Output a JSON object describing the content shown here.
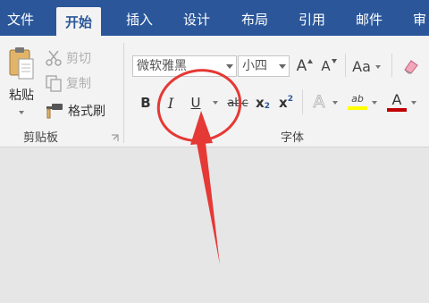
{
  "tabs": [
    {
      "label": "文件"
    },
    {
      "label": "开始"
    },
    {
      "label": "插入"
    },
    {
      "label": "设计"
    },
    {
      "label": "布局"
    },
    {
      "label": "引用"
    },
    {
      "label": "邮件"
    },
    {
      "label": "审"
    }
  ],
  "clipboard": {
    "paste_label": "粘贴",
    "cut_label": "剪切",
    "copy_label": "复制",
    "format_painter_label": "格式刷",
    "group_label": "剪贴板"
  },
  "font": {
    "font_name": "微软雅黑",
    "font_size": "小四",
    "grow_label": "A",
    "shrink_label": "A",
    "change_case_label": "Aa",
    "bold_label": "B",
    "italic_label": "I",
    "underline_label": "U",
    "strikethrough_label": "abc",
    "subscript_label": "x",
    "subscript_sub": "2",
    "superscript_label": "x",
    "superscript_sup": "2",
    "text_effects_label": "A",
    "highlight_label": "ab",
    "font_color_label": "A",
    "group_label": "字体"
  },
  "colors": {
    "tabbar": "#2b579a",
    "highlight": "#ffff00",
    "font_color": "#c00000",
    "annotation": "#e53935"
  }
}
